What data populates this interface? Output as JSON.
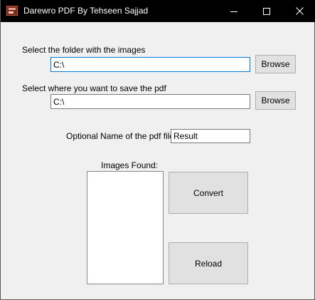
{
  "window": {
    "title": "Darewro PDF By Tehseen Sajjad",
    "icon": "pdf-app-icon",
    "controls": {
      "minimize_icon": "minimize-icon",
      "maximize_icon": "maximize-icon",
      "close_icon": "close-icon"
    }
  },
  "form": {
    "source_folder": {
      "label": "Select the folder with the images",
      "value": "C:\\",
      "browse_label": "Browse"
    },
    "save_location": {
      "label": "Select where you want to save the pdf",
      "value": "C:\\",
      "browse_label": "Browse"
    },
    "pdf_name": {
      "label": "Optional Name of the pdf file:",
      "value": "Result"
    },
    "images_found": {
      "label": "Images Found:",
      "items": []
    },
    "convert_label": "Convert",
    "reload_label": "Reload"
  },
  "colors": {
    "titlebar": "#000000",
    "window_bg": "#f0f0f0",
    "focus_border": "#0078d7",
    "button_bg": "#e1e1e1"
  }
}
